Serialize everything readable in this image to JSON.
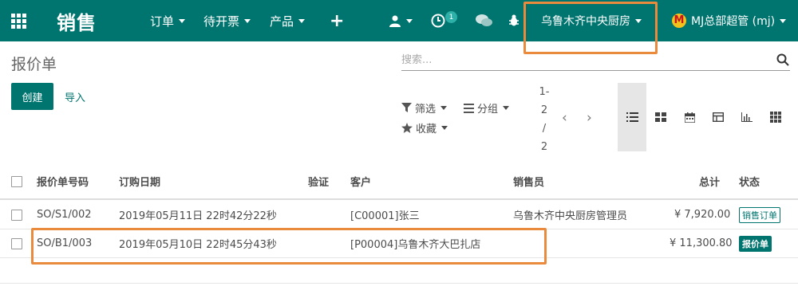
{
  "navbar": {
    "brand": "销售",
    "menu": [
      "订单",
      "待开票",
      "产品"
    ],
    "activity_count": "1",
    "company": "乌鲁木齐中央厨房",
    "user": "MJ总部超管 (mj)",
    "brand_color": "#00756f"
  },
  "control": {
    "title": "报价单",
    "search_placeholder": "搜索...",
    "create": "创建",
    "import": "导入",
    "filters": "筛选",
    "group": "分组",
    "favorites": "收藏",
    "pager": [
      "1-",
      "2",
      "/",
      "2"
    ]
  },
  "table": {
    "columns": [
      "报价单号码",
      "订购日期",
      "验证",
      "客户",
      "销售员",
      "总计",
      "状态"
    ],
    "rows": [
      {
        "number": "SO/S1/002",
        "date": "2019年05月11日 22时42分22秒",
        "validity": "",
        "customer": "[C00001]张三",
        "salesperson": "乌鲁木齐中央厨房管理员",
        "total": "¥ 7,920.00",
        "status": "销售订单"
      },
      {
        "number": "SO/B1/003",
        "date": "2019年05月10日 22时45分43秒",
        "validity": "",
        "customer": "[P00004]乌鲁木齐大巴扎店",
        "salesperson": "",
        "total": "¥ 11,300.80",
        "status": "报价单"
      }
    ]
  }
}
